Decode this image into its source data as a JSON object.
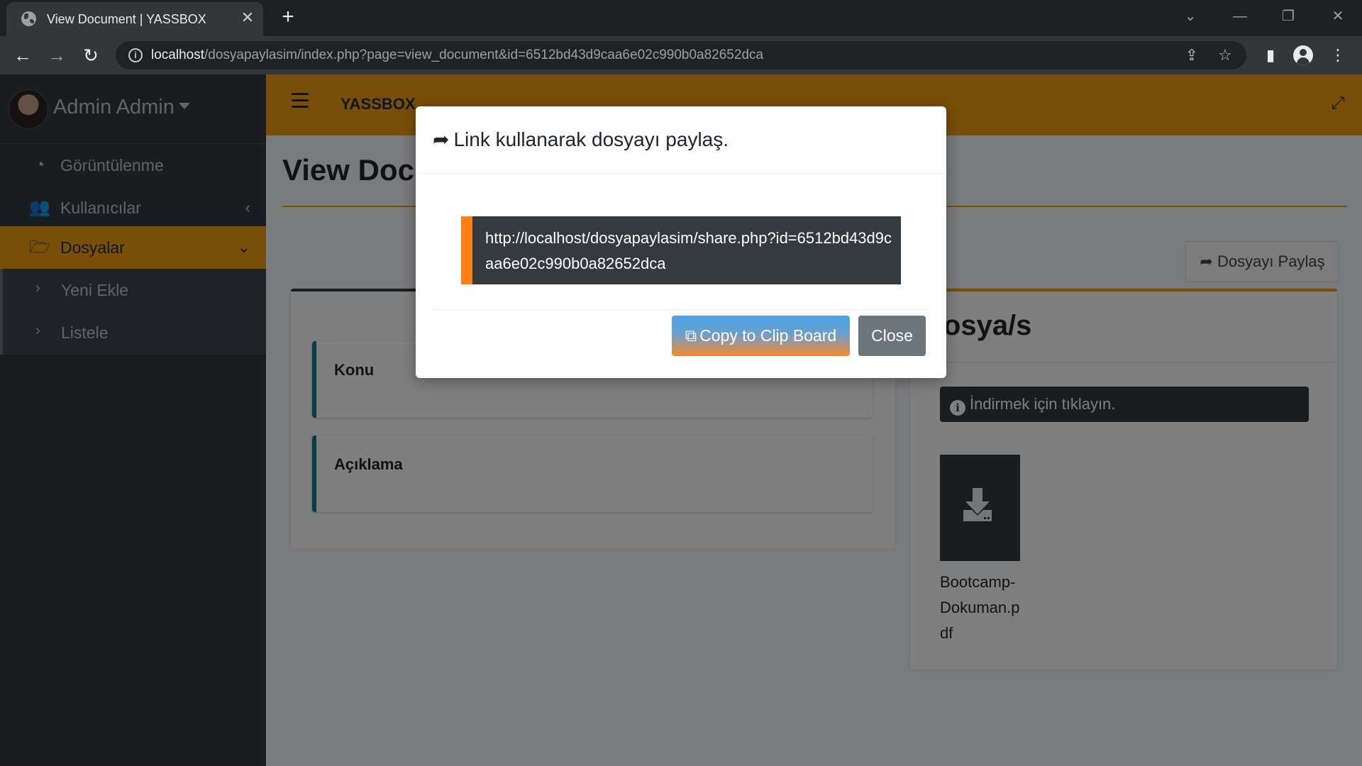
{
  "browser": {
    "tab_title": "View Document | YASSBOX",
    "url_host": "localhost",
    "url_path": "/dosyapaylasim/index.php?page=view_document&id=6512bd43d9caa6e02c990b0a82652dca"
  },
  "sidebar": {
    "user_name": "Admin Admin",
    "items": [
      {
        "label": "Görüntülenme",
        "icon": "dashboard-gauge-icon"
      },
      {
        "label": "Kullanıcılar",
        "icon": "users-icon"
      },
      {
        "label": "Dosyalar",
        "icon": "folder-open-icon"
      }
    ],
    "subitems": [
      {
        "label": "Yeni Ekle"
      },
      {
        "label": "Listele"
      }
    ]
  },
  "navbar": {
    "brand": "YASSBOX"
  },
  "page": {
    "title": "View Document",
    "share_button": "Dosyayı Paylaş",
    "fields": [
      {
        "label": "Konu"
      },
      {
        "label": "Açıklama"
      }
    ],
    "files_card_title": "Dosya/s",
    "download_hint": "İndirmek için tıklayın.",
    "file_name": "Bootcamp-Dokuman.pdf"
  },
  "modal": {
    "title": "Link kullanarak dosyayı paylaş.",
    "link": "http://localhost/dosyapaylasim/share.php?id=6512bd43d9caa6e02c990b0a82652dca",
    "copy_button": "Copy to Clip Board",
    "close_button": "Close"
  },
  "colors": {
    "accent": "#f39c12",
    "sidebar_bg": "#343a40",
    "callout_border": "#117a8b",
    "link_box_border": "#fd7e14"
  }
}
